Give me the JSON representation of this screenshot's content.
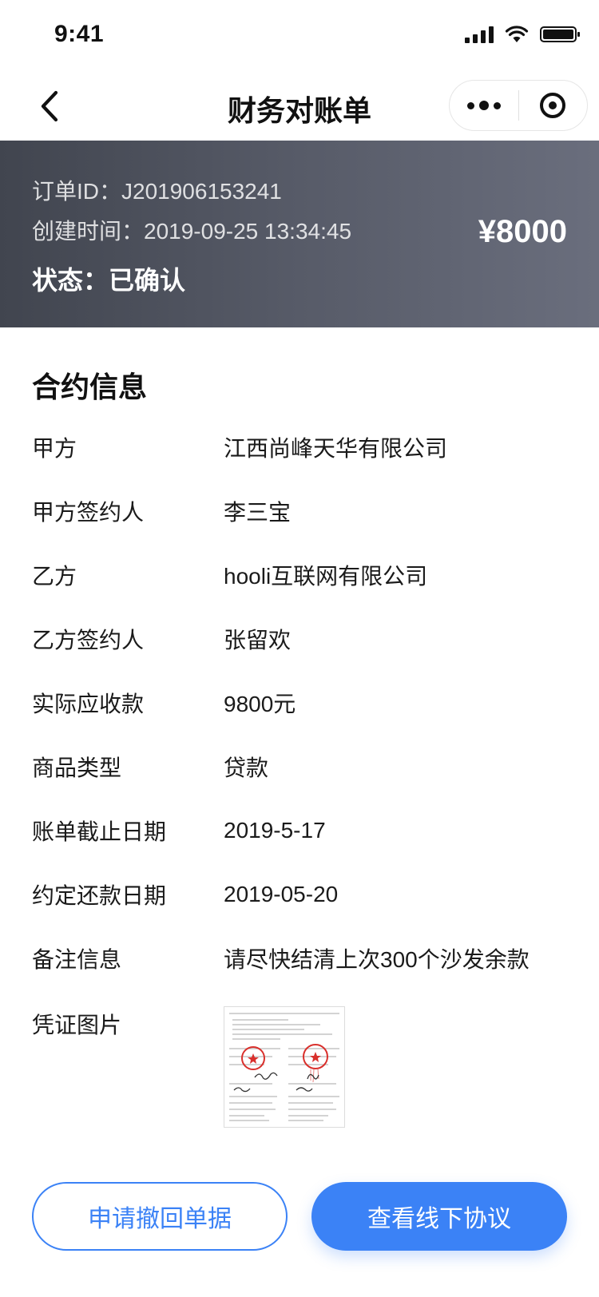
{
  "status_bar": {
    "time": "9:41"
  },
  "nav": {
    "title": "财务对账单"
  },
  "order": {
    "id_label": "订单ID：",
    "id_value": "J201906153241",
    "created_label": "创建时间：",
    "created_value": "2019-09-25 13:34:45",
    "status_label": "状态：",
    "status_value": "已确认",
    "amount": "¥8000"
  },
  "contract": {
    "title": "合约信息",
    "items": [
      {
        "label": "甲方",
        "value": "江西尚峰天华有限公司"
      },
      {
        "label": "甲方签约人",
        "value": "李三宝"
      },
      {
        "label": "乙方",
        "value": "hooli互联网有限公司"
      },
      {
        "label": "乙方签约人",
        "value": "张留欢"
      },
      {
        "label": "实际应收款",
        "value": "9800元"
      },
      {
        "label": "商品类型",
        "value": "贷款"
      },
      {
        "label": "账单截止日期",
        "value": "2019-5-17"
      },
      {
        "label": "约定还款日期",
        "value": "2019-05-20"
      },
      {
        "label": "备注信息",
        "value": "请尽快结清上次300个沙发余款"
      }
    ],
    "voucher_label": "凭证图片"
  },
  "actions": {
    "withdraw_label": "申请撤回单据",
    "view_agreement_label": "查看线下协议"
  },
  "colors": {
    "accent": "#3b82f6",
    "banner_start": "#41454f",
    "banner_end": "#6a6e7d",
    "stamp_red": "#d9302c"
  }
}
